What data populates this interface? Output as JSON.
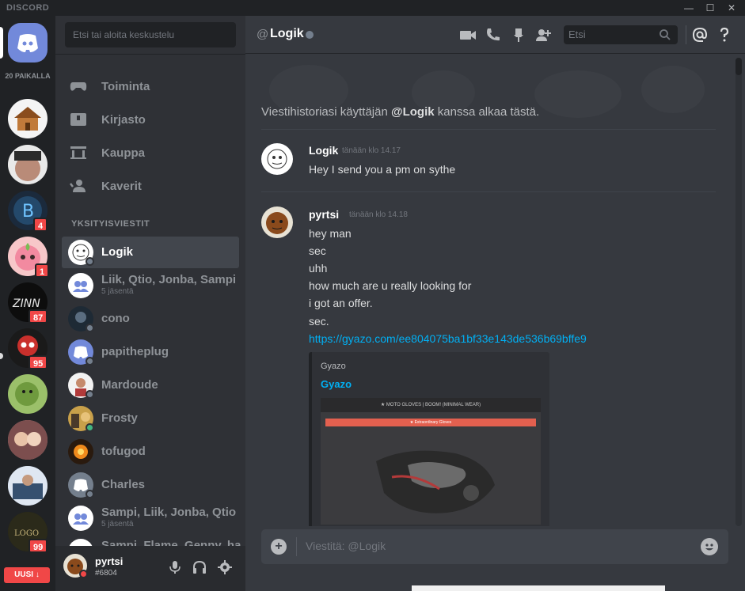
{
  "window": {
    "brand": "DISCORD",
    "minimize": "—",
    "maximize": "☐",
    "close": "✕"
  },
  "guilds": {
    "online_count": "20 PAIKALLA",
    "badges": [
      "4",
      "1",
      "87",
      "95",
      "99"
    ],
    "new_label": "UUSI ↓"
  },
  "sidebar": {
    "search_placeholder": "Etsi tai aloita keskustelu",
    "nav": [
      "Toiminta",
      "Kirjasto",
      "Kauppa",
      "Kaverit"
    ],
    "dm_header": "YKSITYISVIESTIT",
    "dms": [
      {
        "name": "Logik"
      },
      {
        "name": "Liik, Qtio, Jonba, Sampi",
        "sub": "5 jäsentä"
      },
      {
        "name": "cono"
      },
      {
        "name": "papitheplug"
      },
      {
        "name": "Mardoude"
      },
      {
        "name": "Frosty"
      },
      {
        "name": "tofugod"
      },
      {
        "name": "Charles"
      },
      {
        "name": "Sampi, Liik, Jonba, Qtio",
        "sub": "5 jäsentä"
      },
      {
        "name": "Sampi, Flame, Genny, ha"
      }
    ]
  },
  "user": {
    "name": "pyrtsi",
    "tag": "#6804"
  },
  "channel": {
    "at": "@",
    "name": "Logik",
    "search_placeholder": "Etsi"
  },
  "messages": {
    "history_prefix": "Viestihistoriasi käyttäjän ",
    "history_user": "@Logik",
    "history_suffix": " kanssa alkaa tästä.",
    "groups": [
      {
        "author": "Logik",
        "time": "tänään klo 14.17",
        "lines": [
          "Hey I send you a pm on sythe"
        ]
      },
      {
        "author": "pyrtsi",
        "time": "tänään klo 14.18",
        "lines": [
          "hey man",
          "sec",
          "uhh",
          "how much are u really looking for",
          "i got an offer.",
          "sec."
        ],
        "link": "https://gyazo.com/ee804075ba1bf33e143de536b69bffe9",
        "embed": {
          "provider": "Gyazo",
          "title": "Gyazo",
          "image_header": "★ MOTO GLOVES | BOOM! (MINIMAL WEAR)",
          "image_banner": "★ Extraordinary Gloves"
        }
      }
    ]
  },
  "composer": {
    "placeholder": "Viestitä: @Logik"
  },
  "colors": {
    "blurple": "#7289da",
    "link": "#00b0f4",
    "mention_badge": "#f04747",
    "online": "#43b581"
  }
}
